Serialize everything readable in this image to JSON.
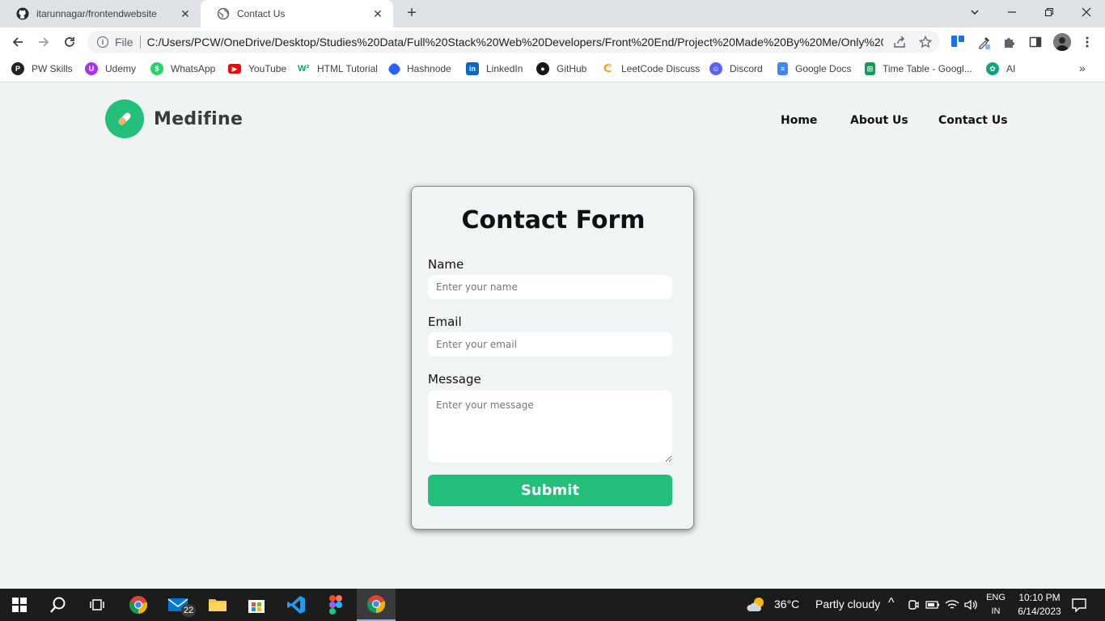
{
  "browser": {
    "tabs": [
      {
        "title": "itarunnagar/frontendwebsite",
        "icon": "github-icon",
        "active": false
      },
      {
        "title": "Contact Us",
        "icon": "globe-icon",
        "active": true
      }
    ],
    "address": {
      "scheme": "File",
      "url": "C:/Users/PCW/OneDrive/Desktop/Studies%20Data/Full%20Stack%20Web%20Developers/Front%20End/Project%20Made%20By%20Me/Only%20S..."
    },
    "bookmarks": [
      {
        "label": "PW Skills",
        "icon": "pwskills-icon",
        "color": "#222222"
      },
      {
        "label": "Udemy",
        "icon": "udemy-icon",
        "color": "#a435f0"
      },
      {
        "label": "WhatsApp",
        "icon": "whatsapp-icon",
        "color": "#25d366"
      },
      {
        "label": "YouTube",
        "icon": "youtube-icon",
        "color": "#ff0000"
      },
      {
        "label": "HTML Tutorial",
        "icon": "w3schools-icon",
        "color": "#04aa6d"
      },
      {
        "label": "Hashnode",
        "icon": "hashnode-icon",
        "color": "#2962ff"
      },
      {
        "label": "LinkedIn",
        "icon": "linkedin-icon",
        "color": "#0a66c2"
      },
      {
        "label": "GitHub",
        "icon": "github-icon",
        "color": "#181717"
      },
      {
        "label": "LeetCode Discuss",
        "icon": "leetcode-icon",
        "color": "#ffa116"
      },
      {
        "label": "Discord",
        "icon": "discord-icon",
        "color": "#5865f2"
      },
      {
        "label": "Google Docs",
        "icon": "google-docs-icon",
        "color": "#4285f4"
      },
      {
        "label": "Time Table - Googl...",
        "icon": "google-sheets-icon",
        "color": "#0f9d58"
      },
      {
        "label": "AI",
        "icon": "openai-icon",
        "color": "#10a37f"
      }
    ]
  },
  "site": {
    "brand": "Medifine",
    "brand_color": "#22bf7b",
    "nav": [
      "Home",
      "About Us",
      "Contact Us"
    ]
  },
  "form": {
    "title": "Contact Form",
    "name_label": "Name",
    "name_placeholder": "Enter your name",
    "email_label": "Email",
    "email_placeholder": "Enter your email",
    "message_label": "Message",
    "message_placeholder": "Enter your message",
    "submit_label": "Submit"
  },
  "taskbar": {
    "mail_badge": "22",
    "weather_temp": "36°C",
    "weather_text": "Partly cloudy",
    "lang": "ENG",
    "region": "IN",
    "time": "10:10 PM",
    "date": "6/14/2023"
  }
}
